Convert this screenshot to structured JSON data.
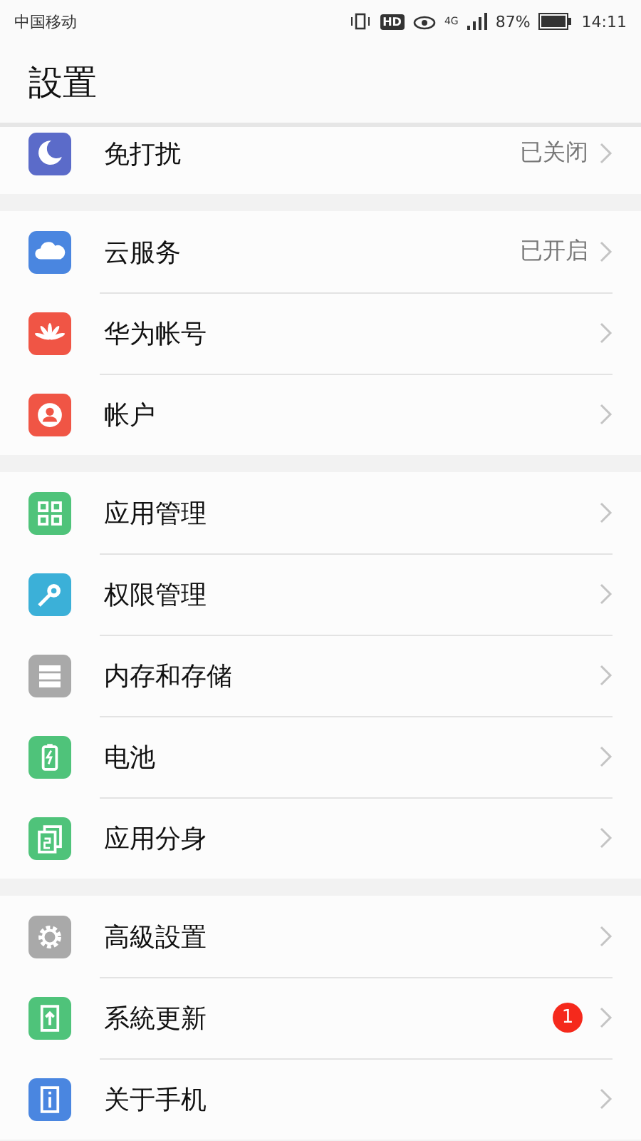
{
  "status_bar": {
    "carrier": "中国移动",
    "hd": "HD",
    "network": "4G",
    "battery": "87%",
    "time": "14:11"
  },
  "title": "設置",
  "groups": [
    {
      "items": [
        {
          "kind": "moon",
          "label": "免打扰",
          "value": "已关闭"
        }
      ]
    },
    {
      "items": [
        {
          "kind": "cloud",
          "label": "云服务",
          "value": "已开启"
        },
        {
          "kind": "petals",
          "label": "华为帐号"
        },
        {
          "kind": "person",
          "label": "帐户"
        }
      ]
    },
    {
      "items": [
        {
          "kind": "grid",
          "label": "应用管理"
        },
        {
          "kind": "key",
          "label": "权限管理"
        },
        {
          "kind": "storage",
          "label": "内存和存储"
        },
        {
          "kind": "battery",
          "label": "电池"
        },
        {
          "kind": "clone",
          "label": "应用分身"
        }
      ]
    },
    {
      "items": [
        {
          "kind": "gear",
          "label": "高級設置"
        },
        {
          "kind": "update",
          "label": "系統更新",
          "badge": "1"
        },
        {
          "kind": "info",
          "label": "关于手机"
        }
      ]
    }
  ]
}
